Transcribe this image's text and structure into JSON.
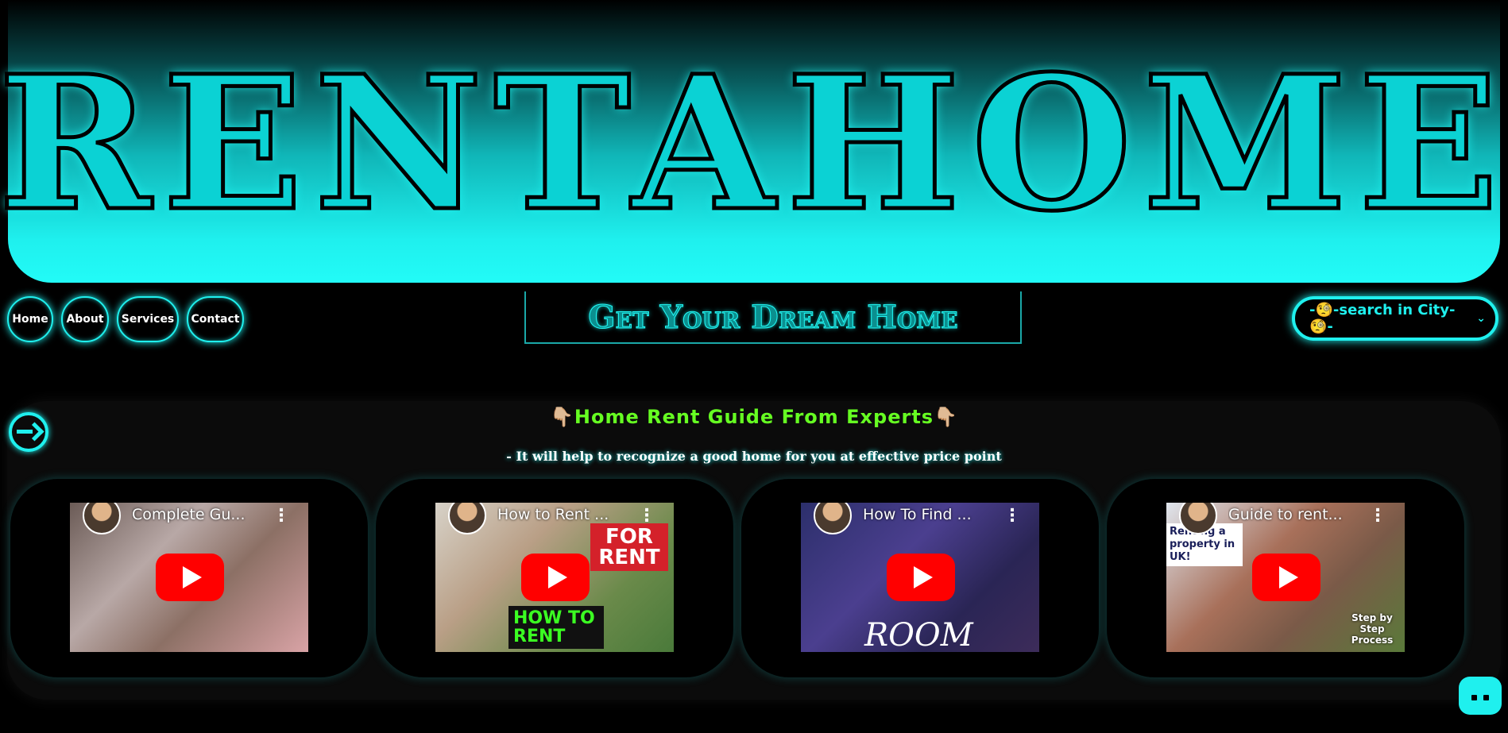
{
  "brand": {
    "title": "RENTAHOME"
  },
  "nav": {
    "items": [
      "Home",
      "About",
      "Services",
      "Contact"
    ]
  },
  "tagline": "Get Your Dream Home",
  "search": {
    "selected": "-🧐-search in City-🧐-"
  },
  "guide": {
    "title": "👇🏼Home Rent Guide From Experts👇🏼",
    "subtitle": "- It will help to recognize a good home for you at effective price point"
  },
  "videos": [
    {
      "title": "Complete Gu..."
    },
    {
      "title": "How to Rent ...",
      "overlay": "FOR RENT",
      "overlay2": "HOW TO RENT"
    },
    {
      "title": "How To Find ...",
      "overlay": "ROOM"
    },
    {
      "title": "Guide to rent...",
      "overlay": "Renting a property in UK!",
      "overlay2": "Step by Step Process"
    }
  ],
  "colors": {
    "accent": "#1ff0ee",
    "guide_title": "#66ff22",
    "play": "#ff0000"
  },
  "icons": {
    "login": "login-icon",
    "chat": "chat-icon",
    "menu": "kebab-icon",
    "play": "play-icon"
  }
}
